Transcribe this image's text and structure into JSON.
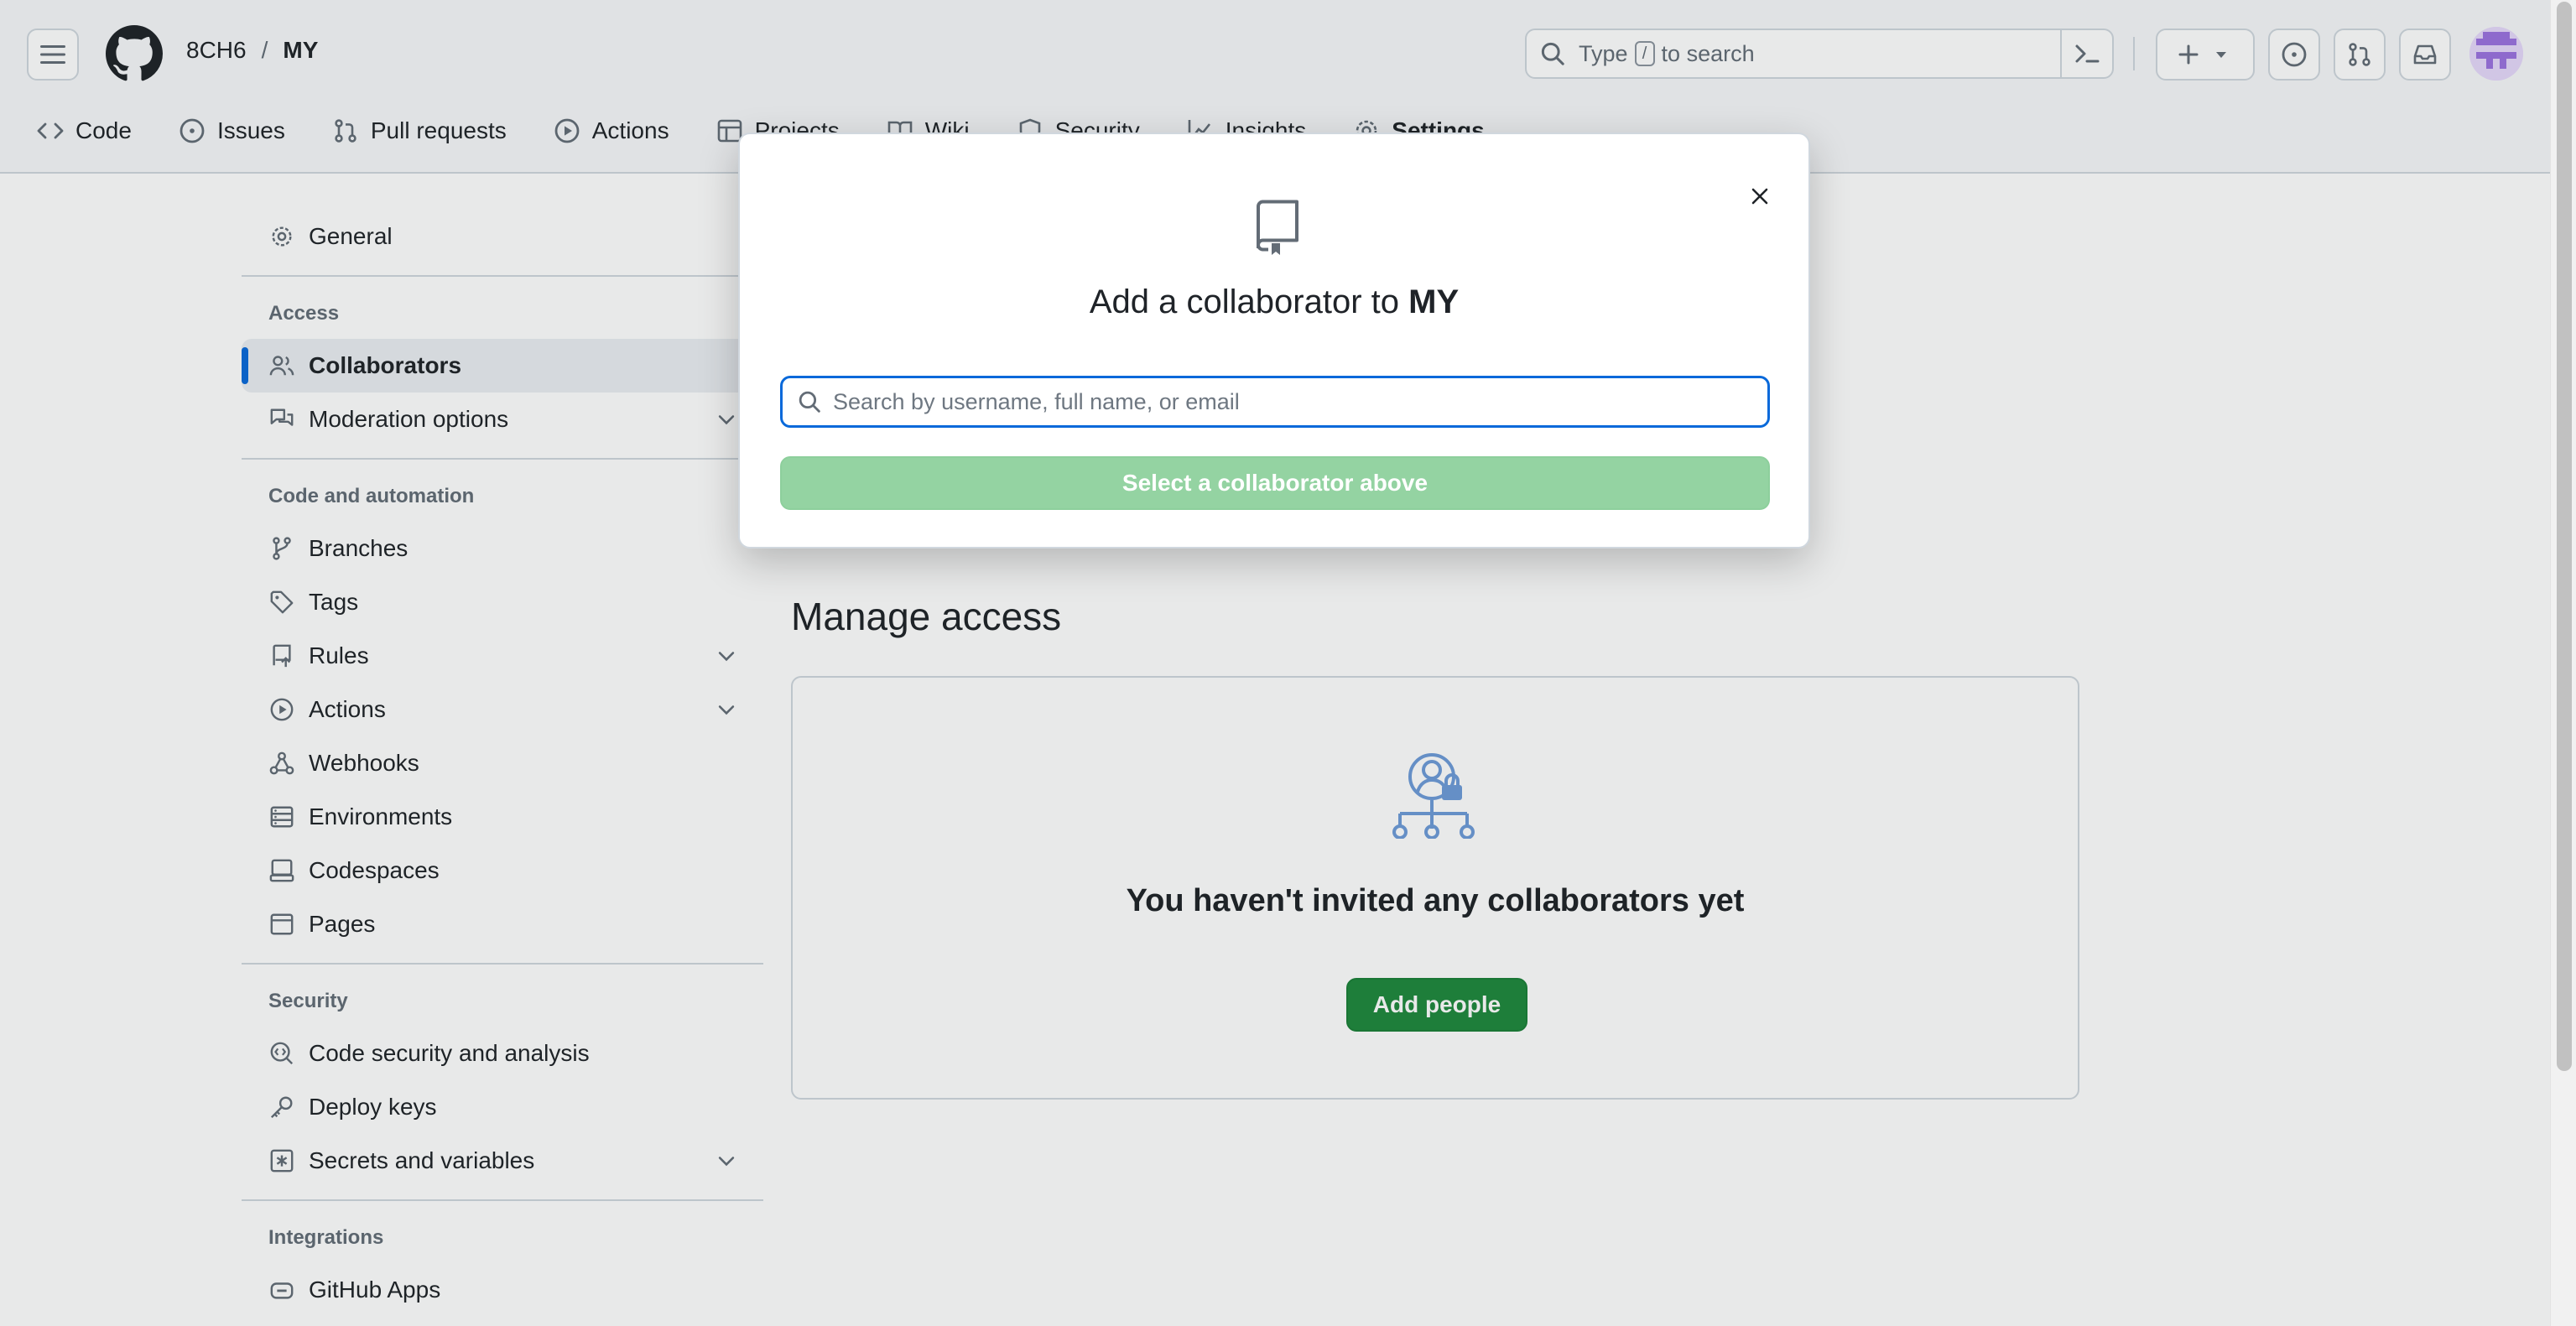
{
  "header": {
    "owner": "8CH6",
    "separator": "/",
    "repo": "MY",
    "search": {
      "before": "Type",
      "key": "/",
      "after": "to search"
    }
  },
  "repo_tabs": [
    {
      "label": "Code",
      "icon": "code-icon"
    },
    {
      "label": "Issues",
      "icon": "issue-opened-icon"
    },
    {
      "label": "Pull requests",
      "icon": "git-pull-request-icon"
    },
    {
      "label": "Actions",
      "icon": "play-icon"
    },
    {
      "label": "Projects",
      "icon": "table-icon"
    },
    {
      "label": "Wiki",
      "icon": "book-icon"
    },
    {
      "label": "Security",
      "icon": "shield-icon"
    },
    {
      "label": "Insights",
      "icon": "graph-icon"
    },
    {
      "label": "Settings",
      "icon": "gear-icon"
    }
  ],
  "sidebar": {
    "general": "General",
    "access_heading": "Access",
    "collaborators": "Collaborators",
    "moderation": "Moderation options",
    "code_heading": "Code and automation",
    "branches": "Branches",
    "tags": "Tags",
    "rules": "Rules",
    "actions": "Actions",
    "webhooks": "Webhooks",
    "environments": "Environments",
    "codespaces": "Codespaces",
    "pages": "Pages",
    "security_heading": "Security",
    "code_security": "Code security and analysis",
    "deploy_keys": "Deploy keys",
    "secrets": "Secrets and variables",
    "integrations_heading": "Integrations",
    "github_apps": "GitHub Apps"
  },
  "main": {
    "manage_title": "Manage access",
    "empty_text": "You haven't invited any collaborators yet",
    "add_people": "Add people"
  },
  "modal": {
    "title_prefix": "Add a collaborator to",
    "title_repo": "MY",
    "search_placeholder": "Search by username, full name, or email",
    "search_value": "",
    "select_button": "Select a collaborator above"
  },
  "colors": {
    "accent": "#0969da",
    "primary_button": "#1f883d",
    "disabled_button": "#94d3a2"
  }
}
